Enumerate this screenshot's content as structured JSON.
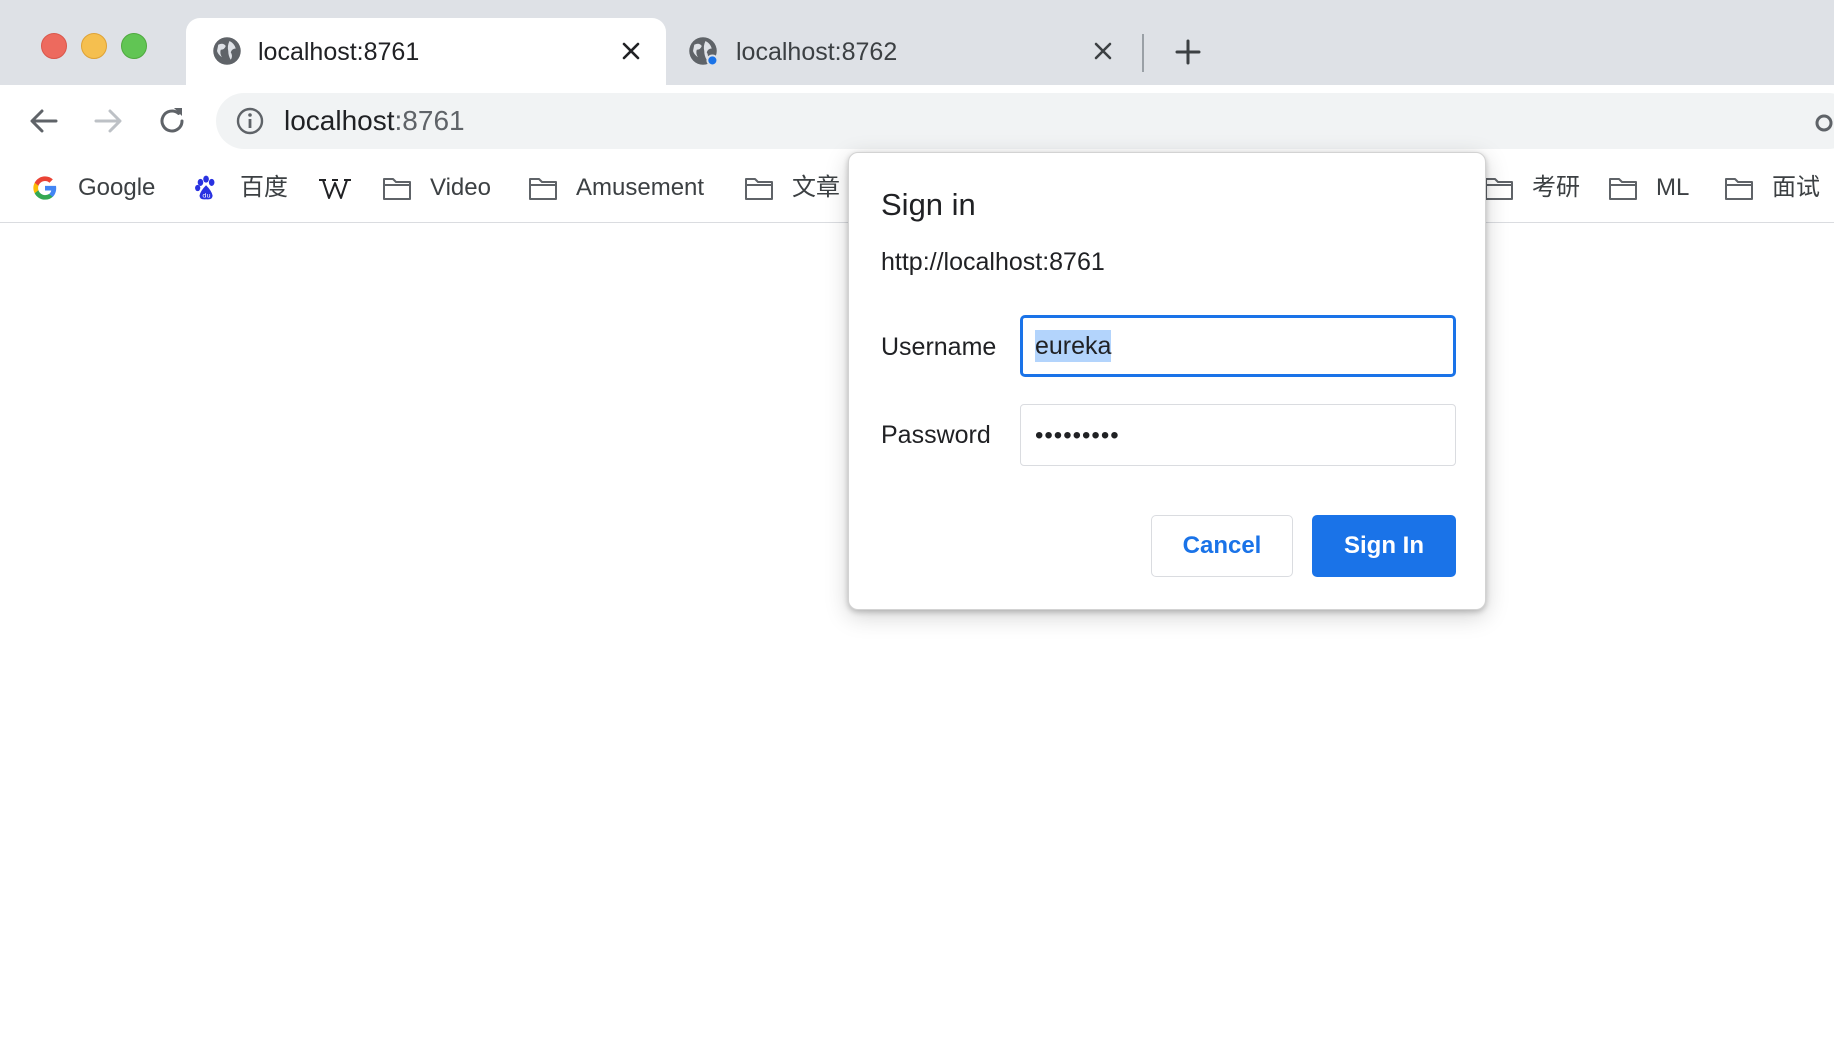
{
  "window": {
    "traffic_lights": [
      "close",
      "minimize",
      "zoom"
    ]
  },
  "tabs": [
    {
      "title": "localhost:8761",
      "active": true,
      "icon": "globe-icon"
    },
    {
      "title": "localhost:8762",
      "active": false,
      "icon": "globe-icon",
      "badge_color": "#1a73e8"
    }
  ],
  "toolbar": {
    "url_host": "localhost",
    "url_port": ":8761"
  },
  "bookmarks": [
    {
      "label": "Google",
      "icon": "google-icon"
    },
    {
      "label": "百度",
      "icon": "baidu-icon"
    },
    {
      "label": "",
      "icon": "wikipedia-icon"
    },
    {
      "label": "Video",
      "icon": "folder-icon"
    },
    {
      "label": "Amusement",
      "icon": "folder-icon"
    },
    {
      "label": "文章",
      "icon": "folder-icon"
    },
    {
      "label": "考研",
      "icon": "folder-icon"
    },
    {
      "label": "ML",
      "icon": "folder-icon"
    },
    {
      "label": "面试",
      "icon": "folder-icon"
    }
  ],
  "dialog": {
    "title": "Sign in",
    "origin": "http://localhost:8761",
    "username_label": "Username",
    "username_value": "eureka",
    "password_label": "Password",
    "password_mask": "•••••••••",
    "cancel_label": "Cancel",
    "signin_label": "Sign In"
  },
  "colors": {
    "accent": "#1a73e8",
    "tabstrip": "#dee1e6",
    "omnibox": "#f1f3f4",
    "selection": "#b3d4fc"
  }
}
